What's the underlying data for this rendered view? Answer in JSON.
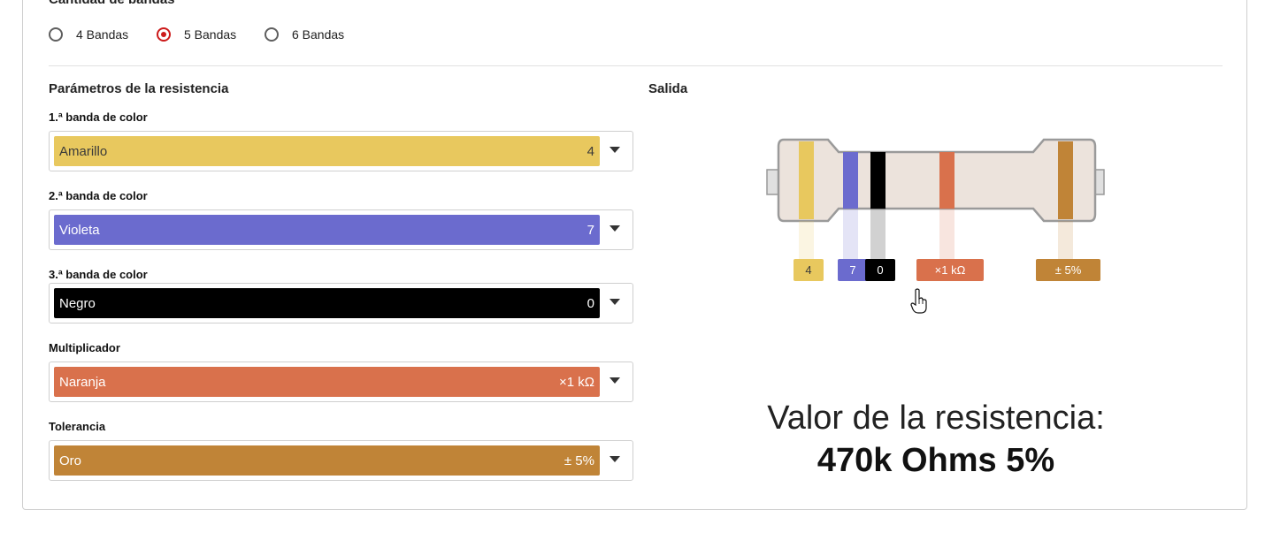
{
  "band_count": {
    "title": "Cantidad de bandas",
    "options": [
      {
        "label": "4 Bandas",
        "selected": false
      },
      {
        "label": "5 Bandas",
        "selected": true
      },
      {
        "label": "6 Bandas",
        "selected": false
      }
    ]
  },
  "params": {
    "title": "Parámetros de la resistencia",
    "fields": [
      {
        "label": "1.ª banda de color",
        "color_name": "Amarillo",
        "value": "4",
        "hex": "#e8c85e"
      },
      {
        "label": "2.ª banda de color",
        "color_name": "Violeta",
        "value": "7",
        "hex": "#6b6bce"
      },
      {
        "label": "3.ª banda de color",
        "color_name": "Negro",
        "value": "0",
        "hex": "#000000"
      },
      {
        "label": "Multiplicador",
        "color_name": "Naranja",
        "value": "×1 kΩ",
        "hex": "#d9714c"
      },
      {
        "label": "Tolerancia",
        "color_name": "Oro",
        "value": "± 5%",
        "hex": "#c08437"
      }
    ]
  },
  "output": {
    "title": "Salida",
    "chips": [
      "4",
      "7",
      "0",
      "×1 kΩ",
      "± 5%"
    ],
    "result_label": "Valor de la resistencia:",
    "result_value": "470k Ohms 5%"
  },
  "colors": {
    "accent_radio": "#cc1a1a",
    "resistor_body": "#ece3dc"
  }
}
